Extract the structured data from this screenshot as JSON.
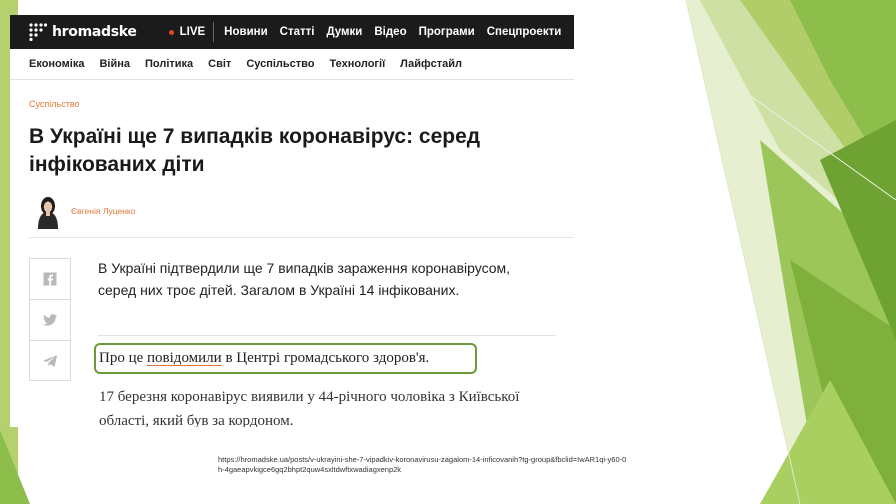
{
  "site": {
    "logo_text": "hromadske",
    "live_label": "LIVE",
    "top_nav": [
      "Новини",
      "Статті",
      "Думки",
      "Відео",
      "Програми",
      "Спецпроекти"
    ],
    "sub_nav": [
      "Економіка",
      "Війна",
      "Політика",
      "Світ",
      "Суспільство",
      "Технології",
      "Лайфстайл"
    ]
  },
  "article": {
    "category": "Суспільство",
    "headline": "В Україні ще 7 випадків коронавірус: серед інфікованих діти",
    "author": "Євгенія Луценко",
    "lead": "В Україні підтвердили ще 7 випадків зараження коронавірусом, серед них троє дітей. Загалом в Україні 14 інфікованих.",
    "para1_before": "Про це ",
    "para1_link": "повідомили",
    "para1_after": " в Центрі громадського здоров'я.",
    "para2": "17 березня коронавірус виявили у 44-річного чоловіка з Київської області, який був за кордоном."
  },
  "share_icons": [
    "facebook-icon",
    "twitter-icon",
    "telegram-icon"
  ],
  "source_url": "https://hromadske.ua/posts/v-ukrayini-she-7-vipadkiv-koronavirusu-zagalom-14-inficovanih?tg-group&fbclid=IwAR1qi-y60-0h-4gaeapvkigce6gq2bhpt2quw4sxltdwftxwadiagxenp2k",
  "colors": {
    "accent_orange": "#e07a3c",
    "highlight_green": "#6e9b3a",
    "topbar_bg": "#1b1b1b",
    "slide_green_light": "#c9dca0",
    "slide_green_mid": "#8dbd4a",
    "slide_green_dark": "#5f8f2a"
  }
}
